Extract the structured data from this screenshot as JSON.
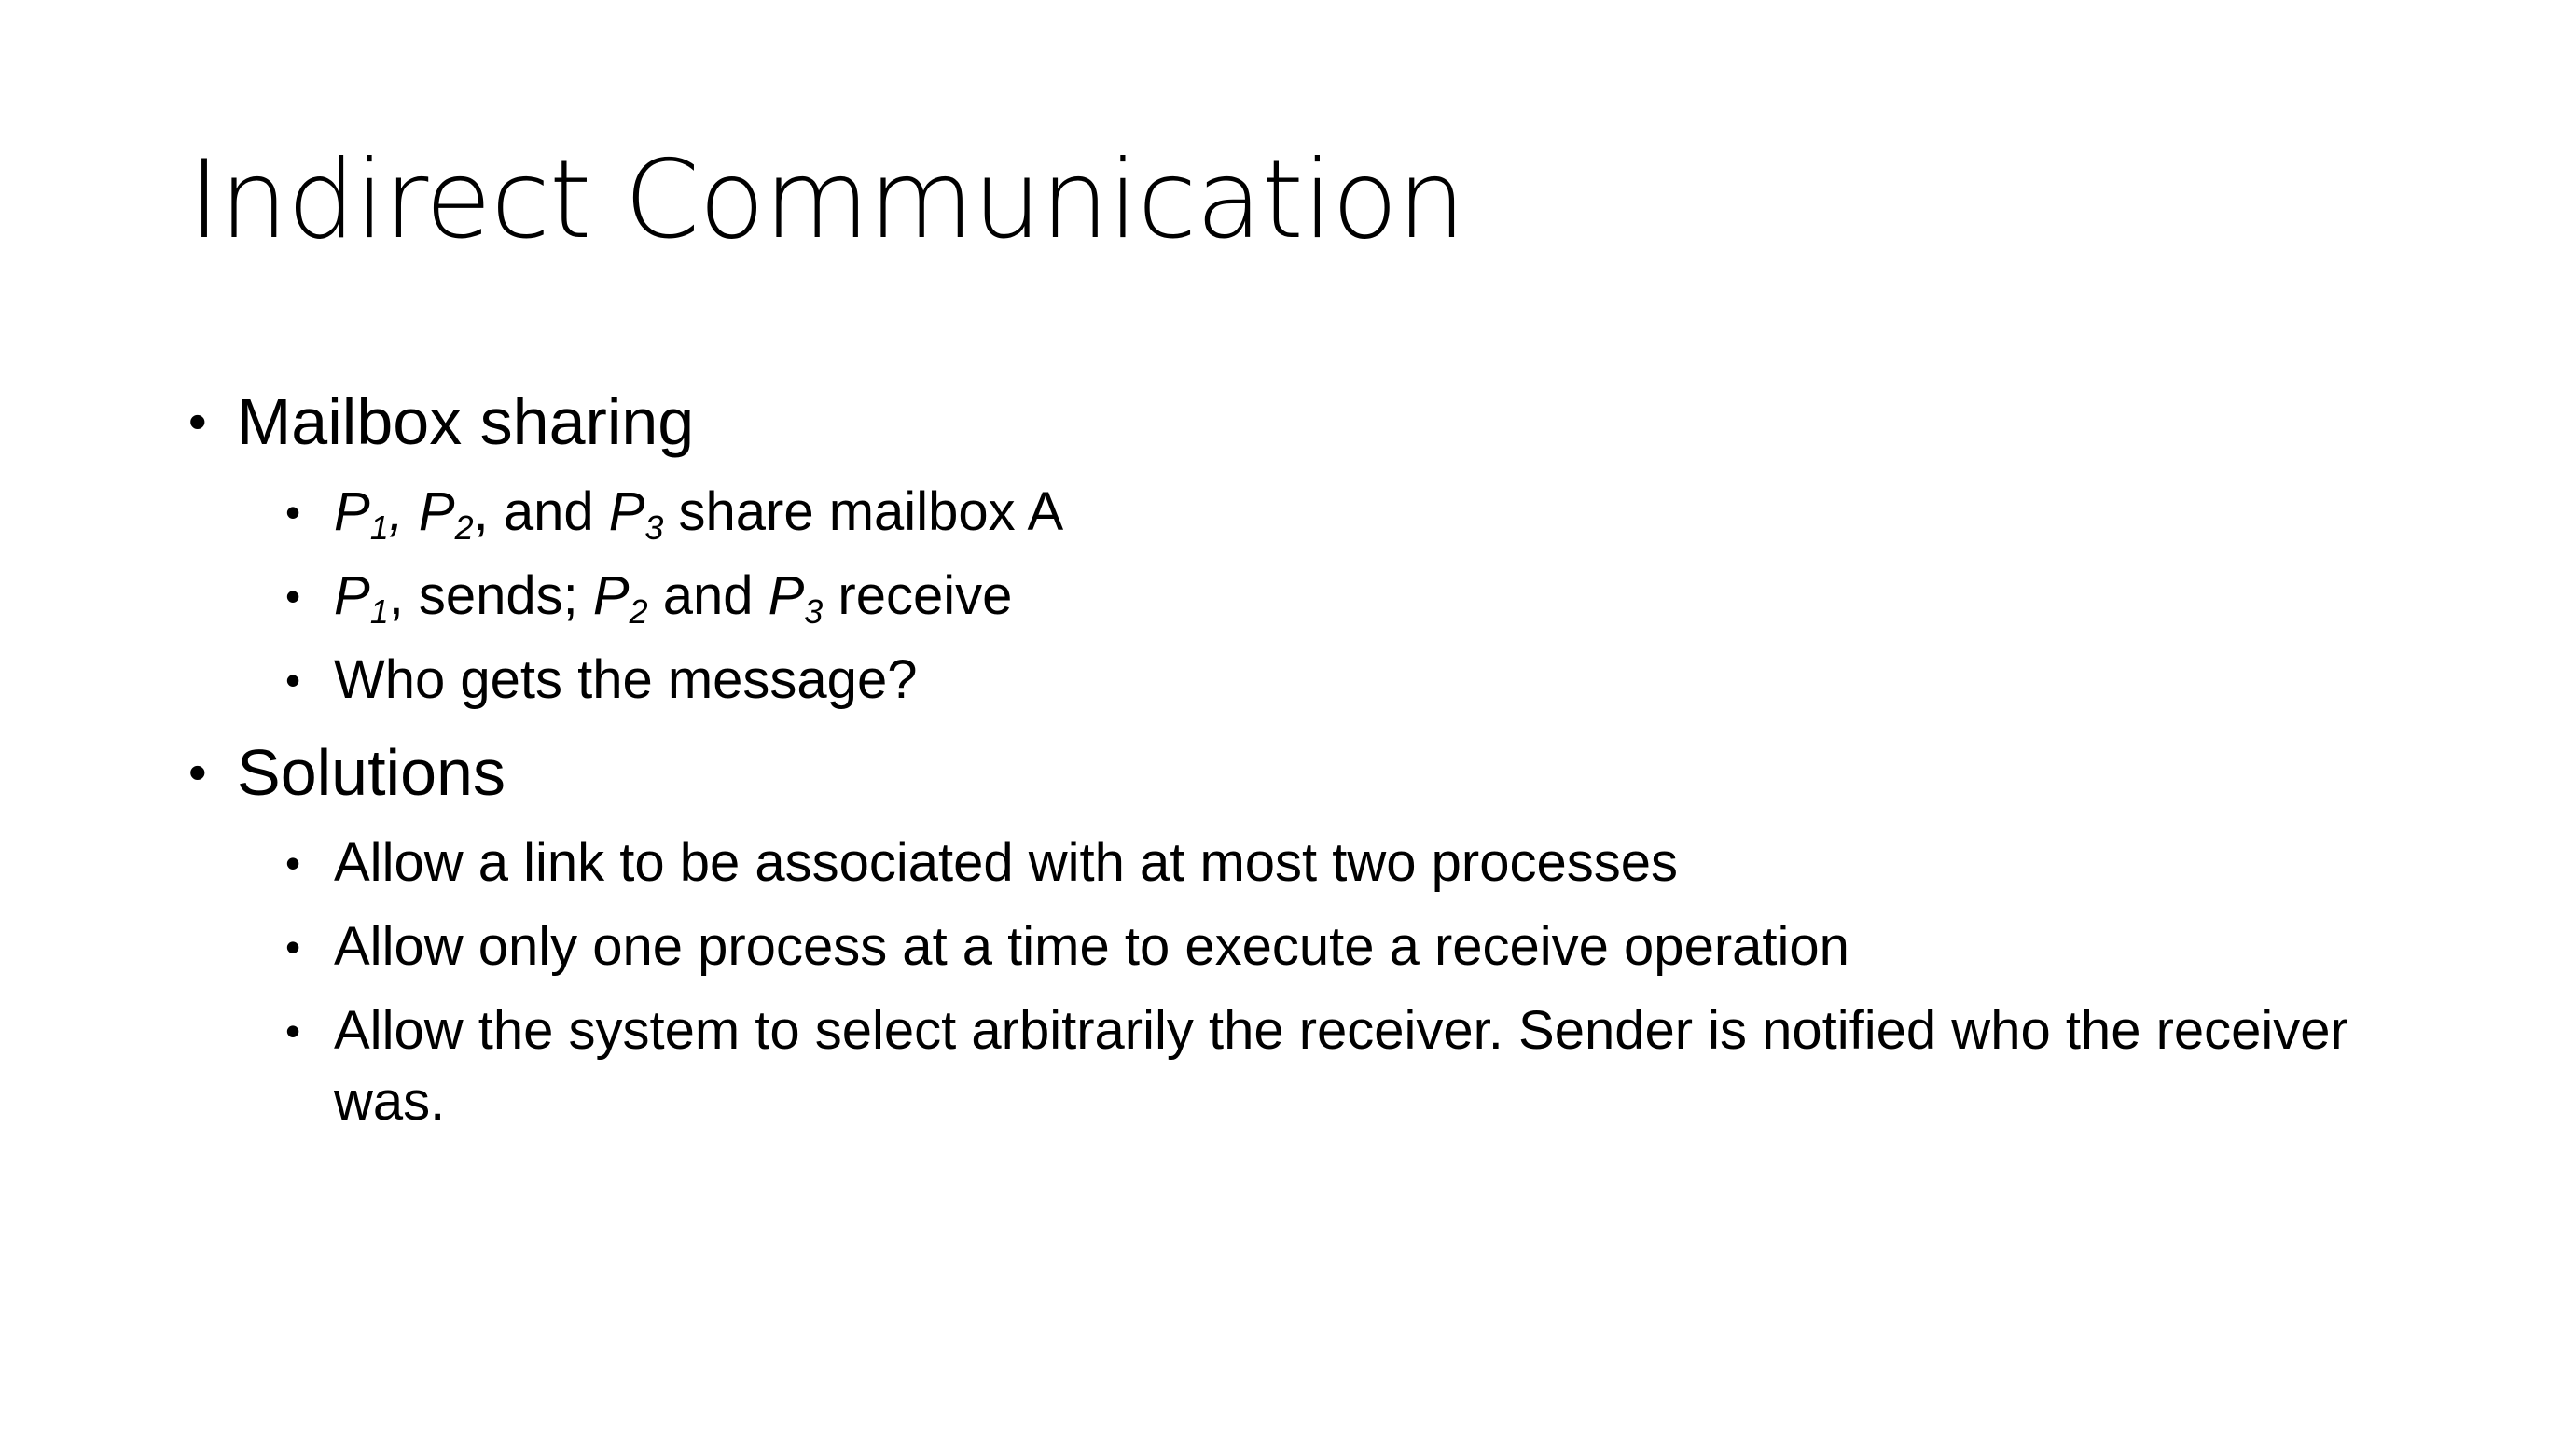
{
  "slide": {
    "title": "Indirect Communication",
    "bullet_char": "•",
    "sections": [
      {
        "heading": "Mailbox sharing",
        "items": [
          {
            "v1": "P",
            "s1": "1",
            "t1": ", ",
            "v2": "P",
            "s2": "2",
            "t2": ", and ",
            "v3": "P",
            "s3": "3",
            "t3": " share mailbox A"
          },
          {
            "v1": "P",
            "s1": "1",
            "t1": ", sends; ",
            "v2": "P",
            "s2": "2",
            "t2": " and ",
            "v3": "P",
            "s3": "3",
            "t3": " receive"
          },
          {
            "text": "Who gets the message?"
          }
        ]
      },
      {
        "heading": "Solutions",
        "items": [
          {
            "text": "Allow a link to be associated with at most two processes"
          },
          {
            "text": "Allow only one process at a time to execute a receive operation"
          },
          {
            "text": "Allow the system to select arbitrarily the receiver.  Sender is notified who the receiver was."
          }
        ]
      }
    ]
  }
}
